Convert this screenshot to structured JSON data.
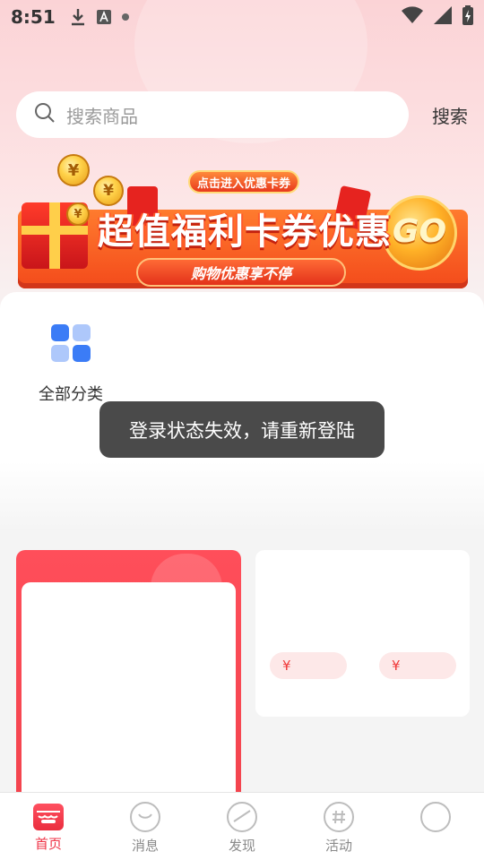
{
  "status_bar": {
    "time": "8:51",
    "left_icons": [
      "download-icon",
      "a-badge-icon",
      "dot-icon"
    ],
    "right_icons": [
      "wifi-icon",
      "signal-icon",
      "battery-charging-icon"
    ]
  },
  "search": {
    "placeholder": "搜索商品",
    "button_label": "搜索"
  },
  "banner": {
    "tag": "点击进入优惠卡券",
    "title": "超值福利卡券优惠",
    "go_text": "GO",
    "subtitle": "购物优惠享不停",
    "coin_symbol": "¥"
  },
  "categories": [
    {
      "label": "全部分类",
      "icon": "grid-icon"
    }
  ],
  "toast": {
    "message": "登录状态失效，请重新登陆"
  },
  "product_card": {
    "prices": [
      "¥",
      "¥"
    ]
  },
  "bottom_nav": {
    "items": [
      {
        "label": "首页",
        "icon": "shop-icon",
        "active": true
      },
      {
        "label": "消息",
        "icon": "chat-icon",
        "active": false
      },
      {
        "label": "发现",
        "icon": "planet-icon",
        "active": false
      },
      {
        "label": "活动",
        "icon": "hashtag-icon",
        "active": false
      },
      {
        "label": "",
        "icon": "profile-icon",
        "active": false
      }
    ]
  },
  "colors": {
    "accent": "#ef3447",
    "banner_orange": "#f34a1b",
    "category_icon_blue": "#3b7cf6",
    "category_icon_light": "#aec8fb"
  }
}
